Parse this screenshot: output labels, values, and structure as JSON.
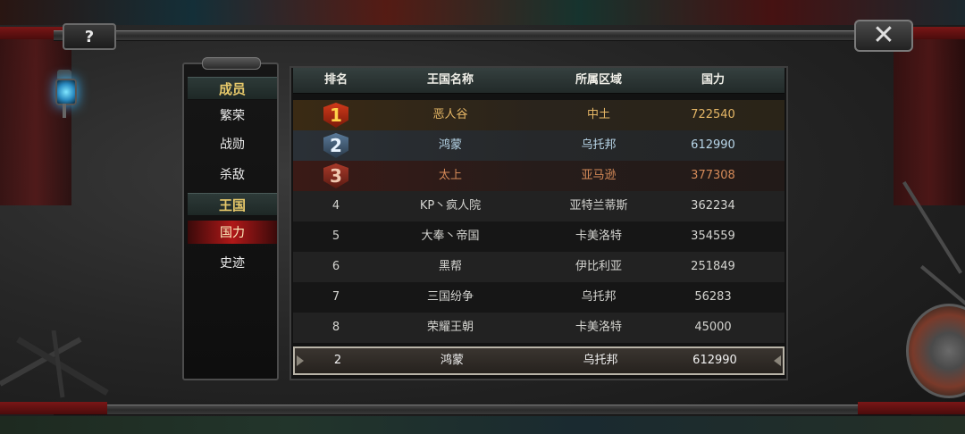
{
  "window": {
    "help_label": "?",
    "close_label": "✕"
  },
  "sidebar": {
    "sections": [
      {
        "header": "成员",
        "items": [
          "繁荣",
          "战勋",
          "杀敌"
        ]
      },
      {
        "header": "王国",
        "items": [
          "国力",
          "史迹"
        ]
      }
    ],
    "active_item": "国力"
  },
  "table": {
    "headers": [
      "排名",
      "王国名称",
      "所属区域",
      "国力"
    ],
    "rows": [
      {
        "rank": "1",
        "name": "恶人谷",
        "region": "中土",
        "power": "722540"
      },
      {
        "rank": "2",
        "name": "鸿蒙",
        "region": "乌托邦",
        "power": "612990"
      },
      {
        "rank": "3",
        "name": "太上",
        "region": "亚马逊",
        "power": "377308"
      },
      {
        "rank": "4",
        "name": "KP丶疯人院",
        "region": "亚特兰蒂斯",
        "power": "362234"
      },
      {
        "rank": "5",
        "name": "大奉丶帝国",
        "region": "卡美洛特",
        "power": "354559"
      },
      {
        "rank": "6",
        "name": "黑帮",
        "region": "伊比利亚",
        "power": "251849"
      },
      {
        "rank": "7",
        "name": "三国纷争",
        "region": "乌托邦",
        "power": "56283"
      },
      {
        "rank": "8",
        "name": "荣耀王朝",
        "region": "卡美洛特",
        "power": "45000"
      }
    ],
    "self_row": {
      "rank": "2",
      "name": "鸿蒙",
      "region": "乌托邦",
      "power": "612990"
    }
  },
  "colors": {
    "rank1_text": "#e6b766",
    "rank2_text": "#b9d7ea",
    "rank3_text": "#d58a58",
    "active_tab": "#b01818",
    "section_header_text": "#e6c86a"
  },
  "icons": {
    "help": "help-icon",
    "close": "close-icon",
    "lantern": "lantern-icon",
    "rank_badges": [
      "rank-1-badge-icon",
      "rank-2-badge-icon",
      "rank-3-badge-icon"
    ]
  }
}
